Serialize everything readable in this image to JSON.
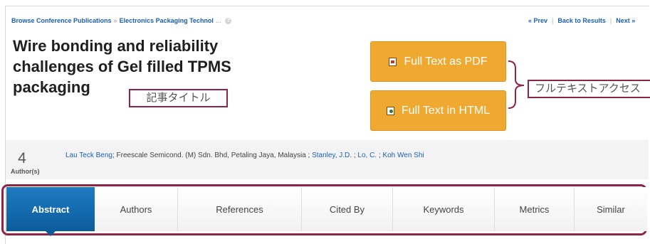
{
  "breadcrumb": {
    "items": [
      "Browse Conference Publications",
      "Electronics Packaging Technol"
    ],
    "separator": "»",
    "ellipsis": "..."
  },
  "pager": {
    "prev": "« Prev",
    "back": "Back to Results",
    "next": "Next »"
  },
  "article": {
    "title": "Wire bonding and reliability challenges of Gel filled TPMS packaging"
  },
  "annotations": {
    "title_note": "記事タイトル",
    "fulltext_note": "フルテキストアクセス"
  },
  "fulltext": {
    "pdf_label": "Full Text as PDF",
    "html_label": "Full Text in HTML"
  },
  "authors": {
    "count": "4",
    "count_label": "Author(s)",
    "first_name": "Lau Teck Beng",
    "first_affiliation": "; Freescale Semicond. (M) Sdn. Bhd, Petaling Jaya, Malaysia ; ",
    "others": [
      "Stanley, J.D.",
      "Lo, C.",
      "Koh Wen Shi"
    ],
    "sep": " ; "
  },
  "tabs": [
    "Abstract",
    "Authors",
    "References",
    "Cited By",
    "Keywords",
    "Metrics",
    "Similar"
  ],
  "active_tab": "Abstract",
  "colors": {
    "accent_orange": "#f0a930",
    "active_tab_blue": "#0c5c9c",
    "annotation_border": "#8e2446",
    "link_blue": "#1a5fb4"
  }
}
